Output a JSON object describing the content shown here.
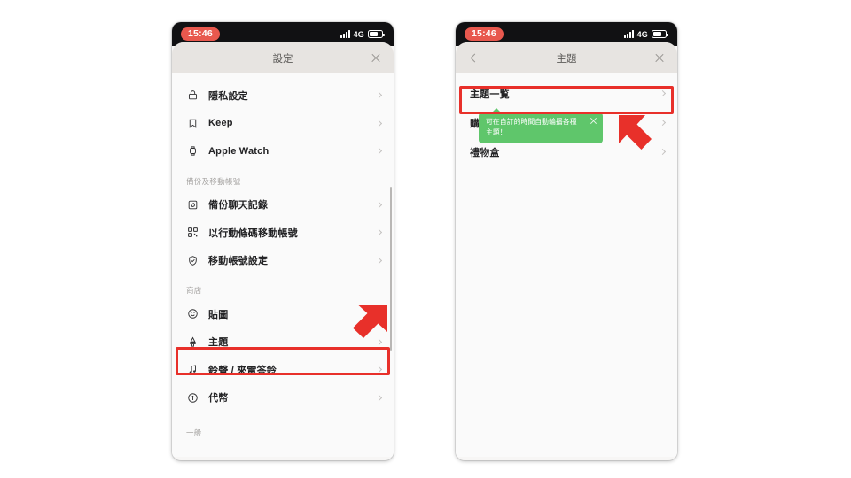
{
  "status_bar": {
    "time": "15:46",
    "network": "4G",
    "signal_icon": "signal-bars-icon",
    "battery_icon": "battery-icon"
  },
  "colors": {
    "accent_red": "#e8302a",
    "time_pill": "#e8584e",
    "tooltip_green": "#5fc66b",
    "navbar": "#e7e4e1",
    "list_bg": "#fafafa"
  },
  "phone_left": {
    "nav": {
      "title": "設定",
      "close_icon": "close-icon"
    },
    "groups": [
      {
        "label": "",
        "items": [
          {
            "label": "隱私設定",
            "icon": "lock-icon",
            "chevron": "chevron-right-icon"
          },
          {
            "label": "Keep",
            "icon": "bookmark-icon",
            "chevron": "chevron-right-icon"
          },
          {
            "label": "Apple Watch",
            "icon": "watch-icon",
            "chevron": "chevron-right-icon"
          }
        ]
      },
      {
        "label": "備份及移動帳號",
        "items": [
          {
            "label": "備份聊天記錄",
            "icon": "backup-icon",
            "chevron": "chevron-right-icon"
          },
          {
            "label": "以行動條碼移動帳號",
            "icon": "qr-code-icon",
            "chevron": "chevron-right-icon"
          },
          {
            "label": "移動帳號設定",
            "icon": "shield-check-icon",
            "chevron": "chevron-right-icon"
          }
        ]
      },
      {
        "label": "商店",
        "items": [
          {
            "label": "貼圖",
            "icon": "smiley-icon",
            "chevron": "chevron-right-icon"
          },
          {
            "label": "主題",
            "icon": "paint-brush-icon",
            "chevron": "chevron-right-icon"
          },
          {
            "label": "鈴聲 / 來電答鈴",
            "icon": "music-note-icon",
            "chevron": "chevron-right-icon"
          },
          {
            "label": "代幣",
            "icon": "coin-icon",
            "chevron": "chevron-right-icon"
          }
        ]
      },
      {
        "label": "一般",
        "items": []
      }
    ]
  },
  "phone_right": {
    "nav": {
      "title": "主題",
      "back_icon": "chevron-left-icon",
      "close_icon": "close-icon"
    },
    "items": [
      {
        "label": "主題一覧",
        "chevron": "chevron-right-icon"
      },
      {
        "label": "購買記錄",
        "chevron": "chevron-right-icon"
      },
      {
        "label": "禮物盒",
        "chevron": "chevron-right-icon"
      }
    ],
    "tooltip": {
      "text": "可在自訂的時間自動輪播各種主題！",
      "close_icon": "close-icon"
    }
  },
  "annotations": {
    "highlight_left": "主題",
    "highlight_right": "主題一覧",
    "arrow_left_icon": "red-arrow-down-left-icon",
    "arrow_right_icon": "red-arrow-up-left-icon"
  }
}
